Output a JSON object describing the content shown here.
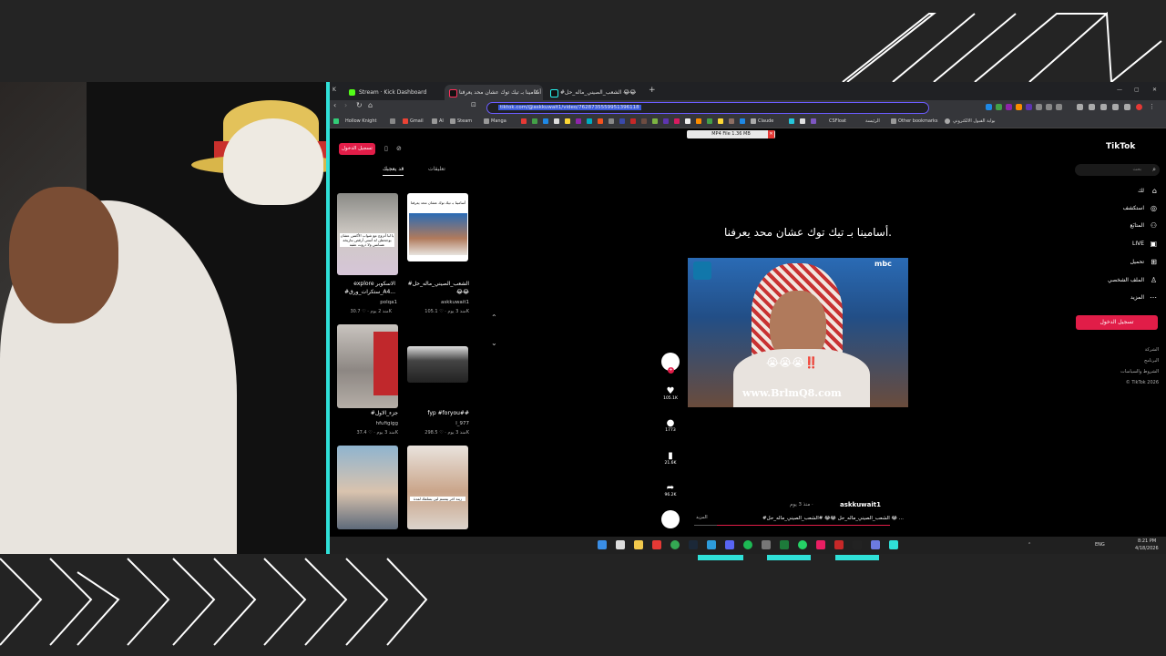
{
  "browser": {
    "tabs": [
      {
        "label": "Stream · Kick Dashboard",
        "icon": "kick-icon",
        "active": false
      },
      {
        "label": "أسامينا بـ تيك توك عشان محد يعرفنا",
        "icon": "tiktok-icon",
        "active": true
      },
      {
        "label": "#الشعب_الصيني_ماله_حل 😂😂",
        "icon": "tiktok-icon",
        "active": false
      }
    ],
    "new_tab": "+",
    "window_controls": {
      "minimize": "—",
      "maximize": "▢",
      "close": "✕"
    },
    "url": "tiktok.com/@askkuwait1/video/7628735559951396118",
    "bookmarks": [
      "Hollow Knight",
      "Gmail",
      "AI",
      "Steam",
      "Manga",
      "Claude",
      "CSFloat",
      "الرئيسة",
      "Other bookmarks",
      "بوابة القبول الالكتروني"
    ],
    "download": "MP4 File 1.36 MB"
  },
  "tiktok": {
    "login_label": "تسجيل الدخول",
    "panel_tabs": {
      "for_you": "قد يعجبك",
      "comments": "تعليقات"
    },
    "thumbnails": [
      {
        "caption": "explore الاسكوبر",
        "caption2": "#ستكرات_ورق_A4...",
        "author": "polqa1",
        "likes": "30.7K",
        "age": "منذ 2 يوم",
        "thumb_text": "يا لبا أتزوج مع شواب الأكتس عشان يوجحطن له أستي أرقص بتاريخه عسانس ولا ذروت عقبه"
      },
      {
        "caption": "#الشعب_الصيني_ماله_حل",
        "caption2": "😂😂",
        "author": "askkuwait1",
        "likes": "105.1K",
        "age": "منذ 3 يوم",
        "thumb_text": "أسامينا بـ تيك توك عشان محد يعرفنا"
      },
      {
        "caption": "#جزء_الاول",
        "caption2": "",
        "author": "hfufigigg",
        "likes": "37.4K",
        "age": "منذ 3 يوم",
        "thumb_text": ""
      },
      {
        "caption": "fyp #foryou##",
        "caption2": "",
        "author": "l_977",
        "likes": "298.5K",
        "age": "منذ 3 يوم",
        "thumb_text": ""
      },
      {
        "caption": "",
        "caption2": "",
        "author": "",
        "likes": "",
        "age": "",
        "thumb_text": ""
      },
      {
        "caption": "",
        "caption2": "",
        "author": "",
        "likes": "",
        "age": "",
        "thumb_text": "زينة اخر يبتسم لين يسلفك لمدة"
      }
    ],
    "video": {
      "title": "أسامينا بـ تيك توك عشان محد يعرفنا.",
      "overlay_emojis": "😭😭😭‼️",
      "watermark": "www.BrlmQ8.com",
      "channel_logo": "mbc"
    },
    "actions": {
      "likes": "105.1K",
      "comments": "1773",
      "saves": "21.6K",
      "shares": "96.2K"
    },
    "description": {
      "author": "askkuwait1",
      "time": "منذ 3 يوم ·",
      "text": "#الشعب_الصيني_ماله_حل 😂😂 #الشعب_الصيني_ماله_حل 😂 ...",
      "more": "المزيد"
    },
    "sidebar": {
      "logo": "TikTok",
      "search_placeholder": "بحث",
      "nav": [
        {
          "label": "لك",
          "icon": "home-icon"
        },
        {
          "label": "استكشف",
          "icon": "compass-icon"
        },
        {
          "label": "المتابَع",
          "icon": "following-icon"
        },
        {
          "label": "LIVE",
          "icon": "live-icon"
        },
        {
          "label": "تحميل",
          "icon": "upload-icon"
        },
        {
          "label": "الملف الشخصي",
          "icon": "profile-icon"
        },
        {
          "label": "المزيد",
          "icon": "more-icon"
        }
      ],
      "login_label": "تسجيل الدخول",
      "footer": [
        "الشركة",
        "البرنامج",
        "الشروط والسياسات",
        "© TikTok 2026"
      ]
    }
  },
  "taskbar": {
    "lang": "ENG",
    "time": "8:21 PM",
    "date": "4/18/2026"
  }
}
